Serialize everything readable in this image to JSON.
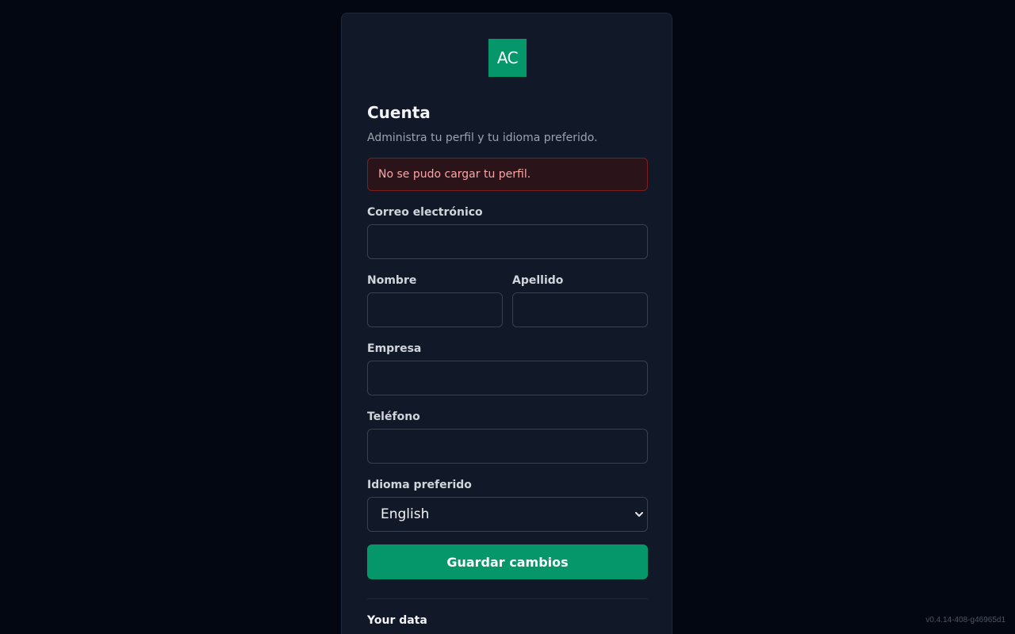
{
  "brand": {
    "logo_text": "AC",
    "logo_color": "#059669"
  },
  "header": {
    "title": "Cuenta",
    "subtitle": "Administra tu perfil y tu idioma preferido."
  },
  "alert": {
    "message": "No se pudo cargar tu perfil.",
    "color": "#fca5a5"
  },
  "form": {
    "email": {
      "label": "Correo electrónico",
      "value": ""
    },
    "first_name": {
      "label": "Nombre",
      "value": ""
    },
    "last_name": {
      "label": "Apellido",
      "value": ""
    },
    "company": {
      "label": "Empresa",
      "value": ""
    },
    "phone": {
      "label": "Teléfono",
      "value": ""
    },
    "language": {
      "label": "Idioma preferido",
      "selected": "English",
      "icon": "chevron-down-icon"
    },
    "save_label": "Guardar cambios"
  },
  "data_section": {
    "title": "Your data"
  },
  "footer": {
    "version": "v0.4.14-408-g46965d1"
  },
  "colors": {
    "background": "#030712",
    "card": "#111827",
    "accent": "#059669",
    "error_border": "#7f1d1d"
  }
}
